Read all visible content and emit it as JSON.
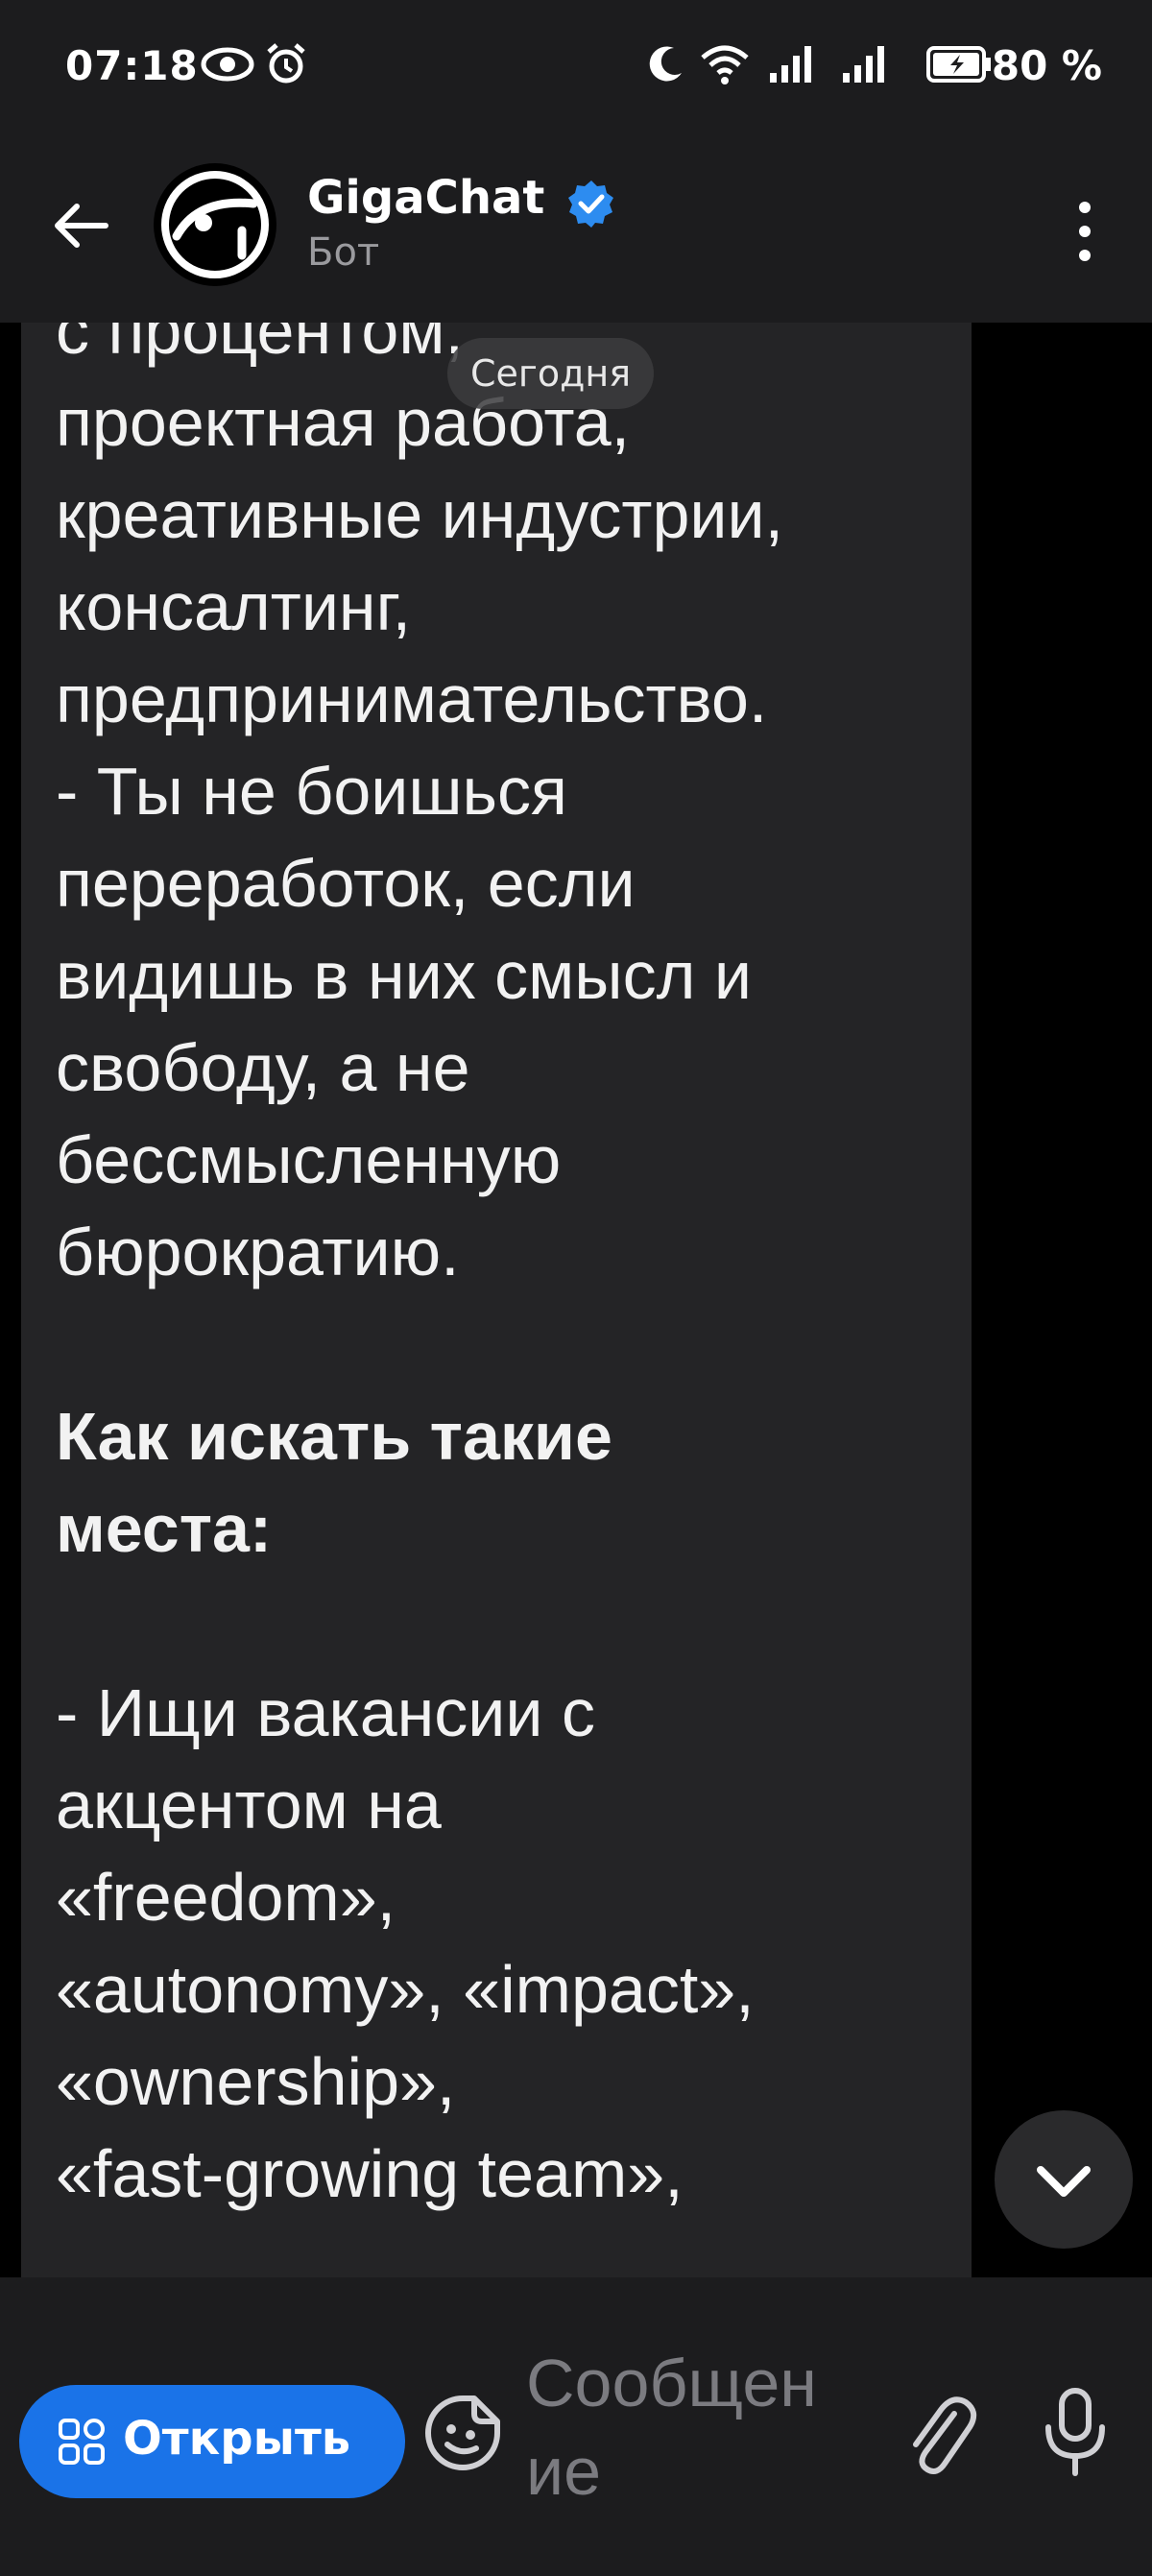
{
  "status_bar": {
    "time": "07:18",
    "battery": "80 %"
  },
  "header": {
    "title": "GigaChat",
    "subtitle": "Бот"
  },
  "date_divider": "Сегодня",
  "message": {
    "lines_part1": [
      "с процентом,",
      "проектная работа,",
      "креативные индустрии,",
      "консалтинг,",
      "предпринимательство.",
      "- Ты не боишься",
      "переработок, если",
      "видишь в них смысл и",
      "свободу, а не",
      "бессмысленную",
      "бюрократию."
    ],
    "heading_lines": [
      "Как искать такие",
      "места:"
    ],
    "lines_part2": [
      "- Ищи вакансии с",
      "акцентом на",
      "«freedom»,",
      "«autonomy», «impact»,",
      "«ownership»,",
      "«fast-growing team»,"
    ]
  },
  "input_bar": {
    "open_button_label": "Открыть",
    "message_placeholder": "Сообщение"
  },
  "colors": {
    "accent": "#1a73e8",
    "bubble": "#242426",
    "bar": "#1c1c1e"
  },
  "icons": [
    "eye-icon",
    "alarm-icon",
    "moon-icon",
    "wifi-icon",
    "signal-icon",
    "battery-icon",
    "back-arrow-icon",
    "gigachat-logo-icon",
    "verified-icon",
    "more-vertical-icon",
    "chevron-down-icon",
    "grid-icon",
    "emoji-icon",
    "paperclip-icon",
    "microphone-icon"
  ]
}
